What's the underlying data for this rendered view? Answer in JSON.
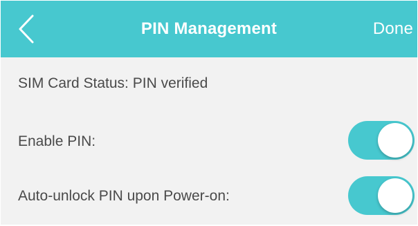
{
  "header": {
    "title": "PIN Management",
    "done_label": "Done"
  },
  "content": {
    "status_text": "SIM Card Status: PIN verified",
    "settings": [
      {
        "label": "Enable PIN:",
        "enabled": true
      },
      {
        "label": "Auto-unlock PIN upon Power-on:",
        "enabled": true
      }
    ]
  },
  "icons": {
    "back": "chevron-left-icon"
  },
  "colors": {
    "header": "#47c8cf",
    "header_text": "#ffffff",
    "background": "#f2f2f2",
    "text": "#4a4a4a",
    "toggle_on": "#47c8cf"
  }
}
